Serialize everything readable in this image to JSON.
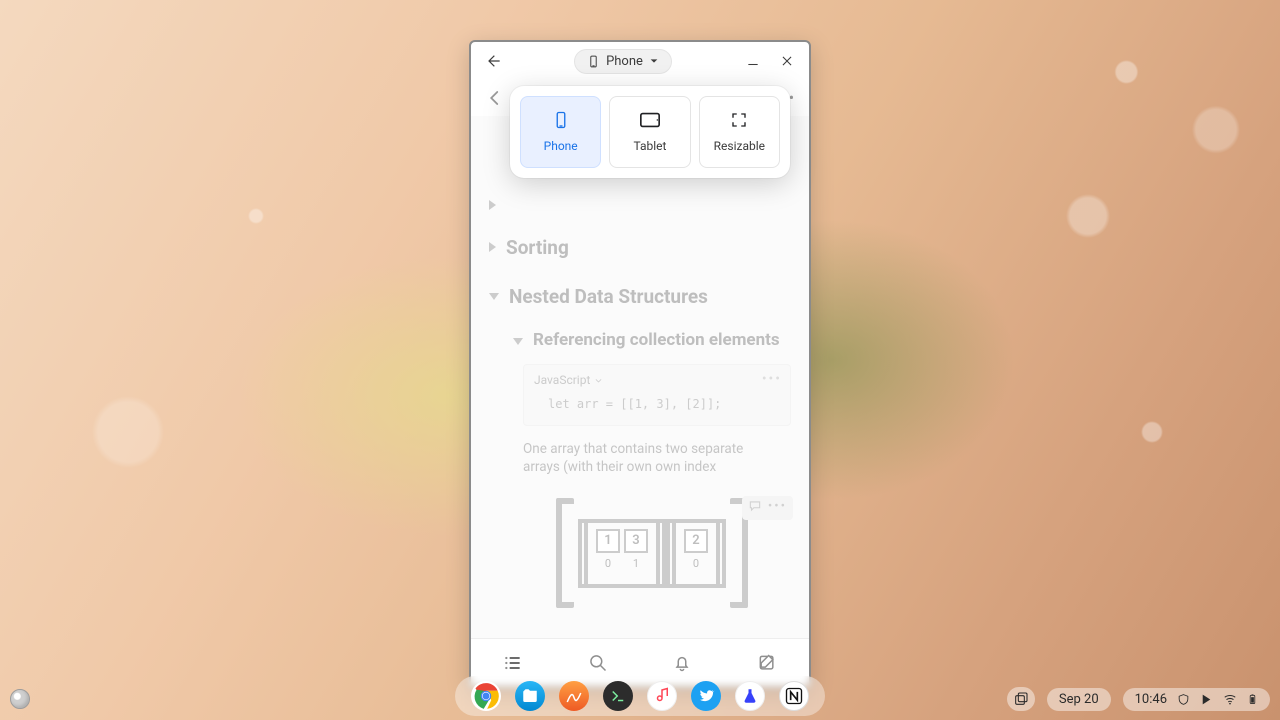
{
  "titlebar": {
    "device_label": "Phone"
  },
  "popover": {
    "options": [
      {
        "label": "Phone"
      },
      {
        "label": "Tablet"
      },
      {
        "label": "Resizable"
      }
    ],
    "active_index": 0
  },
  "document": {
    "section_sorting": "Sorting",
    "section_nested": "Nested Data Structures",
    "section_ref": "Referencing collection elements",
    "code": {
      "language": "JavaScript",
      "text": "let arr = [[1, 3], [2]];"
    },
    "paragraph": "One array that contains two separate arrays (with their own own index",
    "diagram": {
      "left_values": [
        "1",
        "3"
      ],
      "left_indices": [
        "0",
        "1"
      ],
      "right_values": [
        "2"
      ],
      "right_indices": [
        "0"
      ]
    }
  },
  "taskbar": {
    "date": "Sep 20",
    "time": "10:46",
    "dock_apps": [
      "chrome",
      "files",
      "code",
      "terminal",
      "music",
      "twitter",
      "lab",
      "notion"
    ]
  }
}
